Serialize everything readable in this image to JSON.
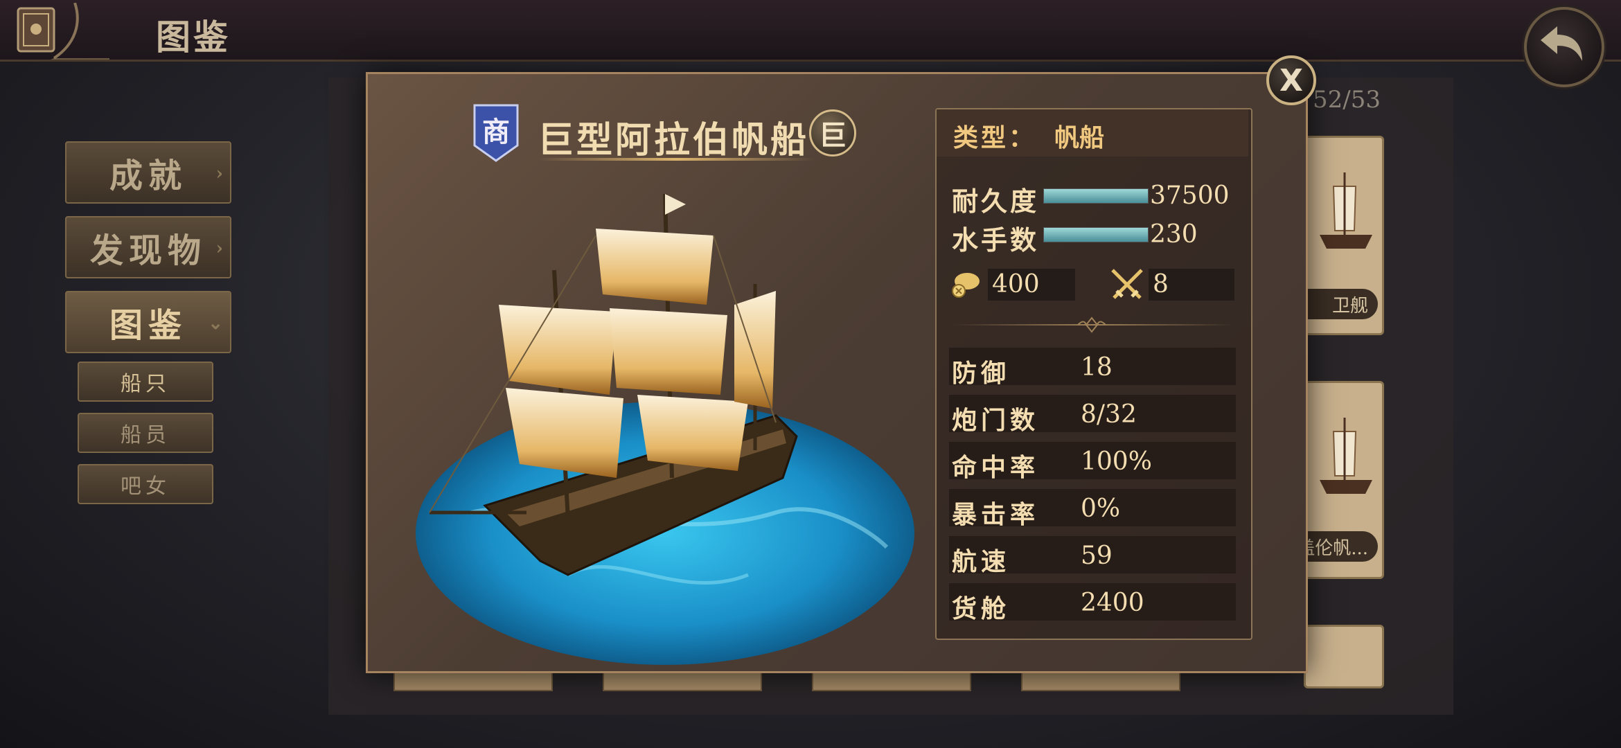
{
  "header": {
    "title": "图鉴"
  },
  "menu": {
    "items": [
      {
        "label": "成就"
      },
      {
        "label": "发现物"
      },
      {
        "label": "图鉴"
      }
    ],
    "sub_items": [
      {
        "label": "船只"
      },
      {
        "label": "船员"
      },
      {
        "label": "吧女"
      }
    ]
  },
  "grid": {
    "counter": "52/53",
    "cards": [
      {
        "label": "卫舰"
      },
      {
        "label": "盖伦帆..."
      }
    ]
  },
  "ship": {
    "class_badge": "商",
    "name": "巨型阿拉伯帆船",
    "size_badge": "巨",
    "type_label": "类型：",
    "type_value": "帆船",
    "durability": {
      "label": "耐久度",
      "value": "37500",
      "fill": 1.0
    },
    "sailors": {
      "label": "水手数",
      "value": "230",
      "fill": 1.0
    },
    "cannon_value": "400",
    "melee_value": "8",
    "stats": [
      {
        "label": "防御",
        "value": "18"
      },
      {
        "label": "炮门数",
        "value": "8/32"
      },
      {
        "label": "命中率",
        "value": "100%"
      },
      {
        "label": "暴击率",
        "value": "0%"
      },
      {
        "label": "航速",
        "value": "59"
      },
      {
        "label": "货舱",
        "value": "2400"
      }
    ]
  },
  "icons": {
    "back": "back-arrow-icon",
    "close": "X",
    "book": "book-icon",
    "cannon": "cannon-icon",
    "swords": "crossed-swords-icon"
  },
  "colors": {
    "accent_gold": "#f0c880",
    "bar_teal": "#7fbcc4",
    "merchant_badge": "#3c52a8"
  }
}
